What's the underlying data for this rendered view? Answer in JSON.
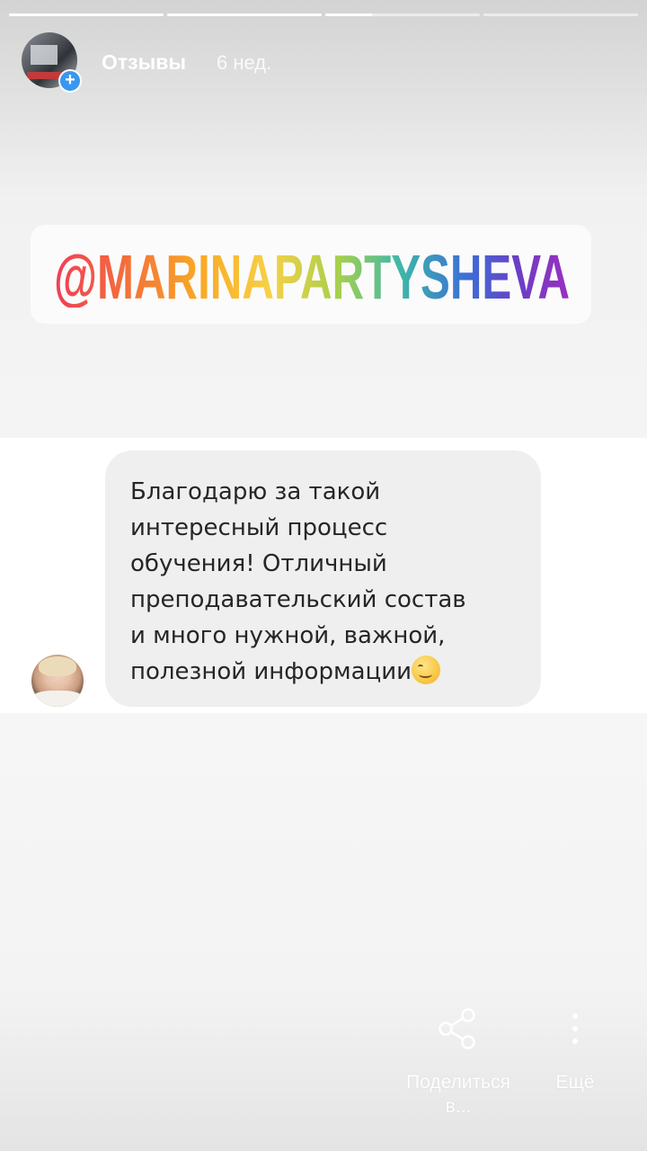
{
  "story": {
    "progress": [
      1.0,
      1.0,
      0.3,
      0.0
    ]
  },
  "header": {
    "username": "Отзывы",
    "time": "6 нед."
  },
  "tag": {
    "text": "@MARINAPARTYSHEVA",
    "gradient_colors": [
      "#ef3e59",
      "#f36b3c",
      "#f9a825",
      "#f6d146",
      "#a7d04c",
      "#3fb8a8",
      "#3b6fd6",
      "#6a3fc6",
      "#9b2fbf"
    ]
  },
  "message": {
    "line1": "Благодарю за такой",
    "line2": "интересный процесс",
    "line3": "обучения! Отличный",
    "line4": "преподавательский состав",
    "line5": "и много нужной, важной,",
    "line6": "полезной информации",
    "emoji": "smiling-face-icon"
  },
  "actions": {
    "share_line1": "Поделиться",
    "share_line2": "в...",
    "more_label": "Ещё"
  },
  "colors": {
    "accent": "#3897f0",
    "bubble": "#efefef",
    "text": "#262626"
  }
}
